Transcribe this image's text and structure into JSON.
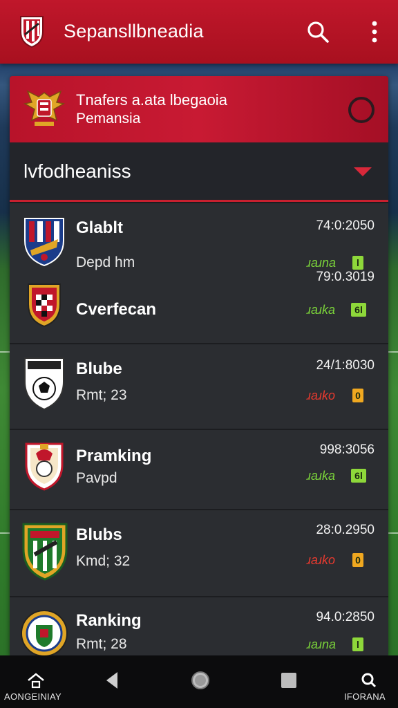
{
  "app": {
    "title": "Sepansllbneadia",
    "theme_color": "#c0172b",
    "logo_icon": "club-shield-logo"
  },
  "top_bar": {
    "search_icon": "search-icon",
    "menu_icon": "more-vertical-icon"
  },
  "banner": {
    "title": "Tnafers a.ata lbegaoia",
    "subtitle": "Pemansia",
    "emblem_icon": "eagle-emblem-icon",
    "radio_icon": "radio-circle-icon"
  },
  "section": {
    "title": "lvfodheaniss",
    "caret_icon": "caret-down-icon"
  },
  "teams": [
    {
      "name": "Glablt",
      "sub": "Depd hm",
      "value": "74:0:2050",
      "tag": "ɹaɹna",
      "badge": "l",
      "tag_color": "green",
      "crest_icon": "striped-shield-icon"
    },
    {
      "name": "Cverfecan",
      "sub": "",
      "value": "79:0.3019",
      "tag": "ɹaɹka",
      "badge": "6l",
      "tag_color": "green",
      "crest_icon": "checkered-shield-icon"
    },
    {
      "name": "Blube",
      "sub": "Rmt; 23",
      "value": "24/1:8030",
      "tag": "ɹaɹko",
      "badge": "0",
      "tag_color": "red",
      "crest_icon": "football-shield-icon"
    },
    {
      "name": "Pramking",
      "sub": "Pavpd",
      "value": "998:3056",
      "tag": "ɹaɹka",
      "badge": "6l",
      "tag_color": "green",
      "crest_icon": "lion-shield-icon"
    },
    {
      "name": "Blubs",
      "sub": "Kmd; 32",
      "value": "28:0.2950",
      "tag": "ɹaɹko",
      "badge": "0",
      "tag_color": "red",
      "crest_icon": "green-shield-icon"
    },
    {
      "name": "Ranking",
      "sub": "Rmt; 28",
      "value": "94.0:2850",
      "tag": "ɹaɹna",
      "badge": "l",
      "tag_color": "green",
      "crest_icon": "round-crest-icon"
    }
  ],
  "bottom_nav": {
    "home_label": "AONGEINIAY",
    "right_label": "IFORANA",
    "home_icon": "home-icon",
    "back_icon": "back-triangle-icon",
    "home_circle_icon": "home-circle-icon",
    "recents_icon": "recents-square-icon",
    "search_icon": "search-icon"
  }
}
